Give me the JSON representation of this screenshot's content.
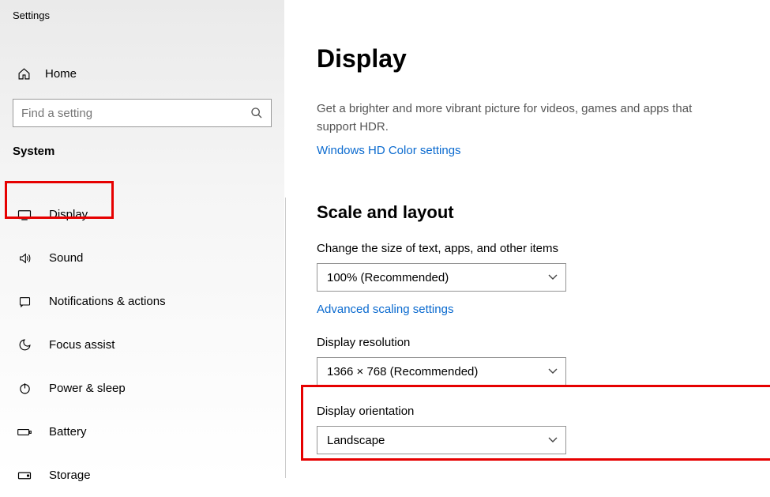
{
  "window": {
    "title": "Settings"
  },
  "sidebar": {
    "home": "Home",
    "search_placeholder": "Find a setting",
    "section": "System",
    "items": [
      {
        "label": "Display"
      },
      {
        "label": "Sound"
      },
      {
        "label": "Notifications & actions"
      },
      {
        "label": "Focus assist"
      },
      {
        "label": "Power & sleep"
      },
      {
        "label": "Battery"
      },
      {
        "label": "Storage"
      }
    ]
  },
  "main": {
    "title": "Display",
    "hdr_desc": "Get a brighter and more vibrant picture for videos, games and apps that support HDR.",
    "hdr_link": "Windows HD Color settings",
    "section_scale": "Scale and layout",
    "scale_label": "Change the size of text, apps, and other items",
    "scale_value": "100% (Recommended)",
    "adv_scale_link": "Advanced scaling settings",
    "res_label": "Display resolution",
    "res_value": "1366 × 768 (Recommended)",
    "orient_label": "Display orientation",
    "orient_value": "Landscape"
  }
}
